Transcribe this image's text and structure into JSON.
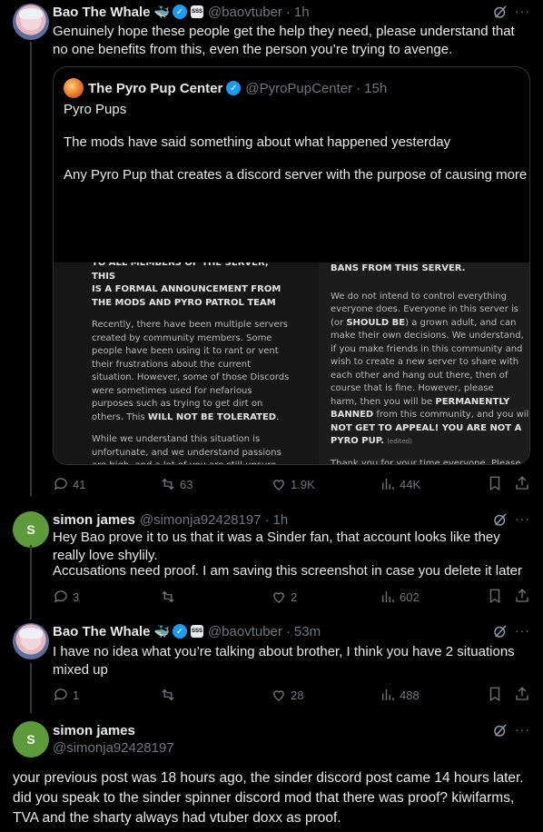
{
  "post1": {
    "name": "Bao The Whale",
    "whale_emoji": "🐳",
    "affiliate_badge": "SSS",
    "handle": "@baovtuber",
    "time": "1h",
    "text": "Genuinely hope these people get the help they need, please understand that no one benefits from this, even the person you’re trying to avenge.",
    "quote": {
      "name": "The Pyro Pup Center",
      "handle": "@PyroPupCenter",
      "time": "15h",
      "line1": "Pyro Pups",
      "line2": "The mods have said something about what happened yesterday",
      "line3": "Any Pyro Pup that creates a discord server with the purpose of causing more ...",
      "image": {
        "left_p1_top": "TO ALL MEMBERS OF THE SERVER, THIS",
        "left_p1_bold": "IS A FORMAL ANNOUNCEMENT FROM THE MODS AND PYRO PATROL TEAM",
        "left_p2": "Recently, there have been multiple servers created by community members. Some people have been using it to rant or vent their frustrations about the current situation. However, some of those Discords were sometimes used for nefarious purposes such as trying to get dirt on others. This",
        "left_p2_bold": "WILL NOT BE TOLERATED",
        "left_p2_end": ".",
        "left_p3": "While we understand this situation is unfortunate, and we understand passions are high, and a lot of you are still unsure about what will happen in the future. We the mods are unsure as well. However, these branching servers have caused numerous issues, despite us informing these parties to not engage further with the mess we dealt with",
        "right_heading": "BANS FROM THIS SERVER.",
        "right_p1_a": "We do not intend to control everything everyone does. Everyone in this server is (or",
        "right_p1_bold": "SHOULD BE",
        "right_p1_b": ") a grown adult, and can make their own decisions. We understand, if you make friends in this community and wish to create a new server to share with each other and hang out there, then of course that is fine. However, please understand, there are",
        "right_p2_a": "harm, then you will be",
        "right_p2_bold1": "PERMANENTLY BANNED",
        "right_p2_b": "from this community, and you will",
        "right_p2_bold2": "NOT GET TO APPEAL! YOU ARE NOT A PYRO PUP.",
        "right_edited": "(edited)",
        "right_p3": "Thank you for your time everyone. Please take a deep breath, calm down, drink some water and relax. Please consider what it means to be a Pyro Pup."
      }
    },
    "stats": {
      "replies": "41",
      "reposts": "63",
      "likes": "1.9K",
      "views": "44K"
    }
  },
  "post2": {
    "avatar_letter": "S",
    "name": "simon james",
    "handle": "@simonja92428197",
    "time": "1h",
    "text_line1": "Hey Bao prove it to us that it was a Sinder fan, that account looks like they really love shylily.",
    "text_line2": "Accusations need proof. I am saving this screenshot in case you delete it later",
    "stats": {
      "replies": "3",
      "reposts": "",
      "likes": "2",
      "views": "602"
    }
  },
  "post3": {
    "name": "Bao The Whale",
    "whale_emoji": "🐳",
    "affiliate_badge": "SSS",
    "handle": "@baovtuber",
    "time": "53m",
    "text": "I have no idea what you’re talking about brother, I think you have 2 situations mixed up",
    "stats": {
      "replies": "1",
      "reposts": "",
      "likes": "28",
      "views": "488"
    }
  },
  "post4": {
    "avatar_letter": "S",
    "name": "simon james",
    "handle": "@simonja92428197",
    "text": "your previous post was 18 hours ago, the sinder discord post came 14 hours later. did you speak to the sinder spinner discord mod that there was proof? kiwifarms, TVA and the sharty always had vtuber doxx as proof."
  },
  "separators": {
    "dot": "·",
    "more": "···"
  },
  "colors": {
    "background": "#000000",
    "text": "#e7e9ea",
    "muted": "#71767b",
    "verified": "#1d9bf0",
    "border": "#2f3336"
  },
  "icons": [
    "grok-icon",
    "more-icon",
    "reply-icon",
    "repost-icon",
    "like-icon",
    "views-icon",
    "bookmark-icon",
    "share-icon",
    "verified-icon"
  ]
}
